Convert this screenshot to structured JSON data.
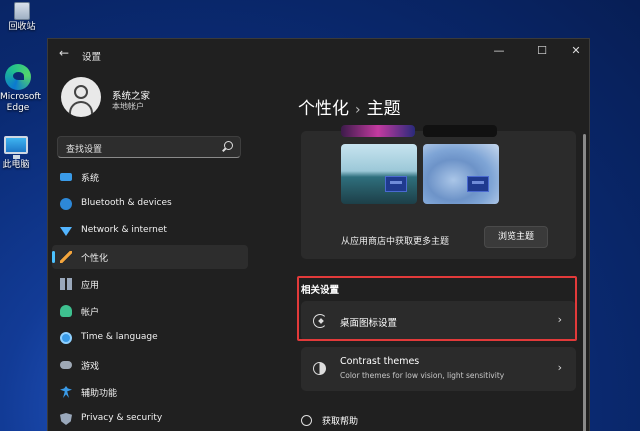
{
  "desktop": {
    "icons": [
      {
        "label": "回收站",
        "icon": "recycle-bin-icon"
      },
      {
        "label": "Microsoft Edge",
        "icon": "edge-icon"
      },
      {
        "label": "此电脑",
        "icon": "this-pc-icon"
      }
    ]
  },
  "window": {
    "title": "设置",
    "back_glyph": "←",
    "minimize_glyph": "—",
    "maximize_glyph": "☐",
    "close_glyph": "✕"
  },
  "profile": {
    "name": "系统之家",
    "account_type": "本地帐户"
  },
  "search": {
    "placeholder": "查找设置"
  },
  "sidebar": {
    "items": [
      {
        "label": "系统",
        "icon": "system-icon"
      },
      {
        "label": "Bluetooth & devices",
        "icon": "bluetooth-icon"
      },
      {
        "label": "Network & internet",
        "icon": "network-icon"
      },
      {
        "label": "个性化",
        "icon": "personalization-icon",
        "active": true
      },
      {
        "label": "应用",
        "icon": "apps-icon"
      },
      {
        "label": "帐户",
        "icon": "accounts-icon"
      },
      {
        "label": "Time & language",
        "icon": "time-language-icon"
      },
      {
        "label": "游戏",
        "icon": "gaming-icon"
      },
      {
        "label": "辅助功能",
        "icon": "accessibility-icon"
      },
      {
        "label": "Privacy & security",
        "icon": "privacy-security-icon"
      }
    ]
  },
  "breadcrumb": {
    "parent": "个性化",
    "separator": "›",
    "current": "主题"
  },
  "themes": {
    "store_label": "从应用商店中获取更多主题",
    "browse_button": "浏览主题"
  },
  "related": {
    "heading": "相关设置",
    "desktop_icons": "桌面图标设置",
    "contrast_title": "Contrast themes",
    "contrast_sub": "Color themes for low vision, light sensitivity",
    "chevron": "›"
  },
  "help": {
    "label": "获取帮助"
  },
  "colors": {
    "accent": "#4cc2ff",
    "highlight": "#e23a3a",
    "window_bg": "#202020",
    "card_bg": "#2b2b2b"
  }
}
